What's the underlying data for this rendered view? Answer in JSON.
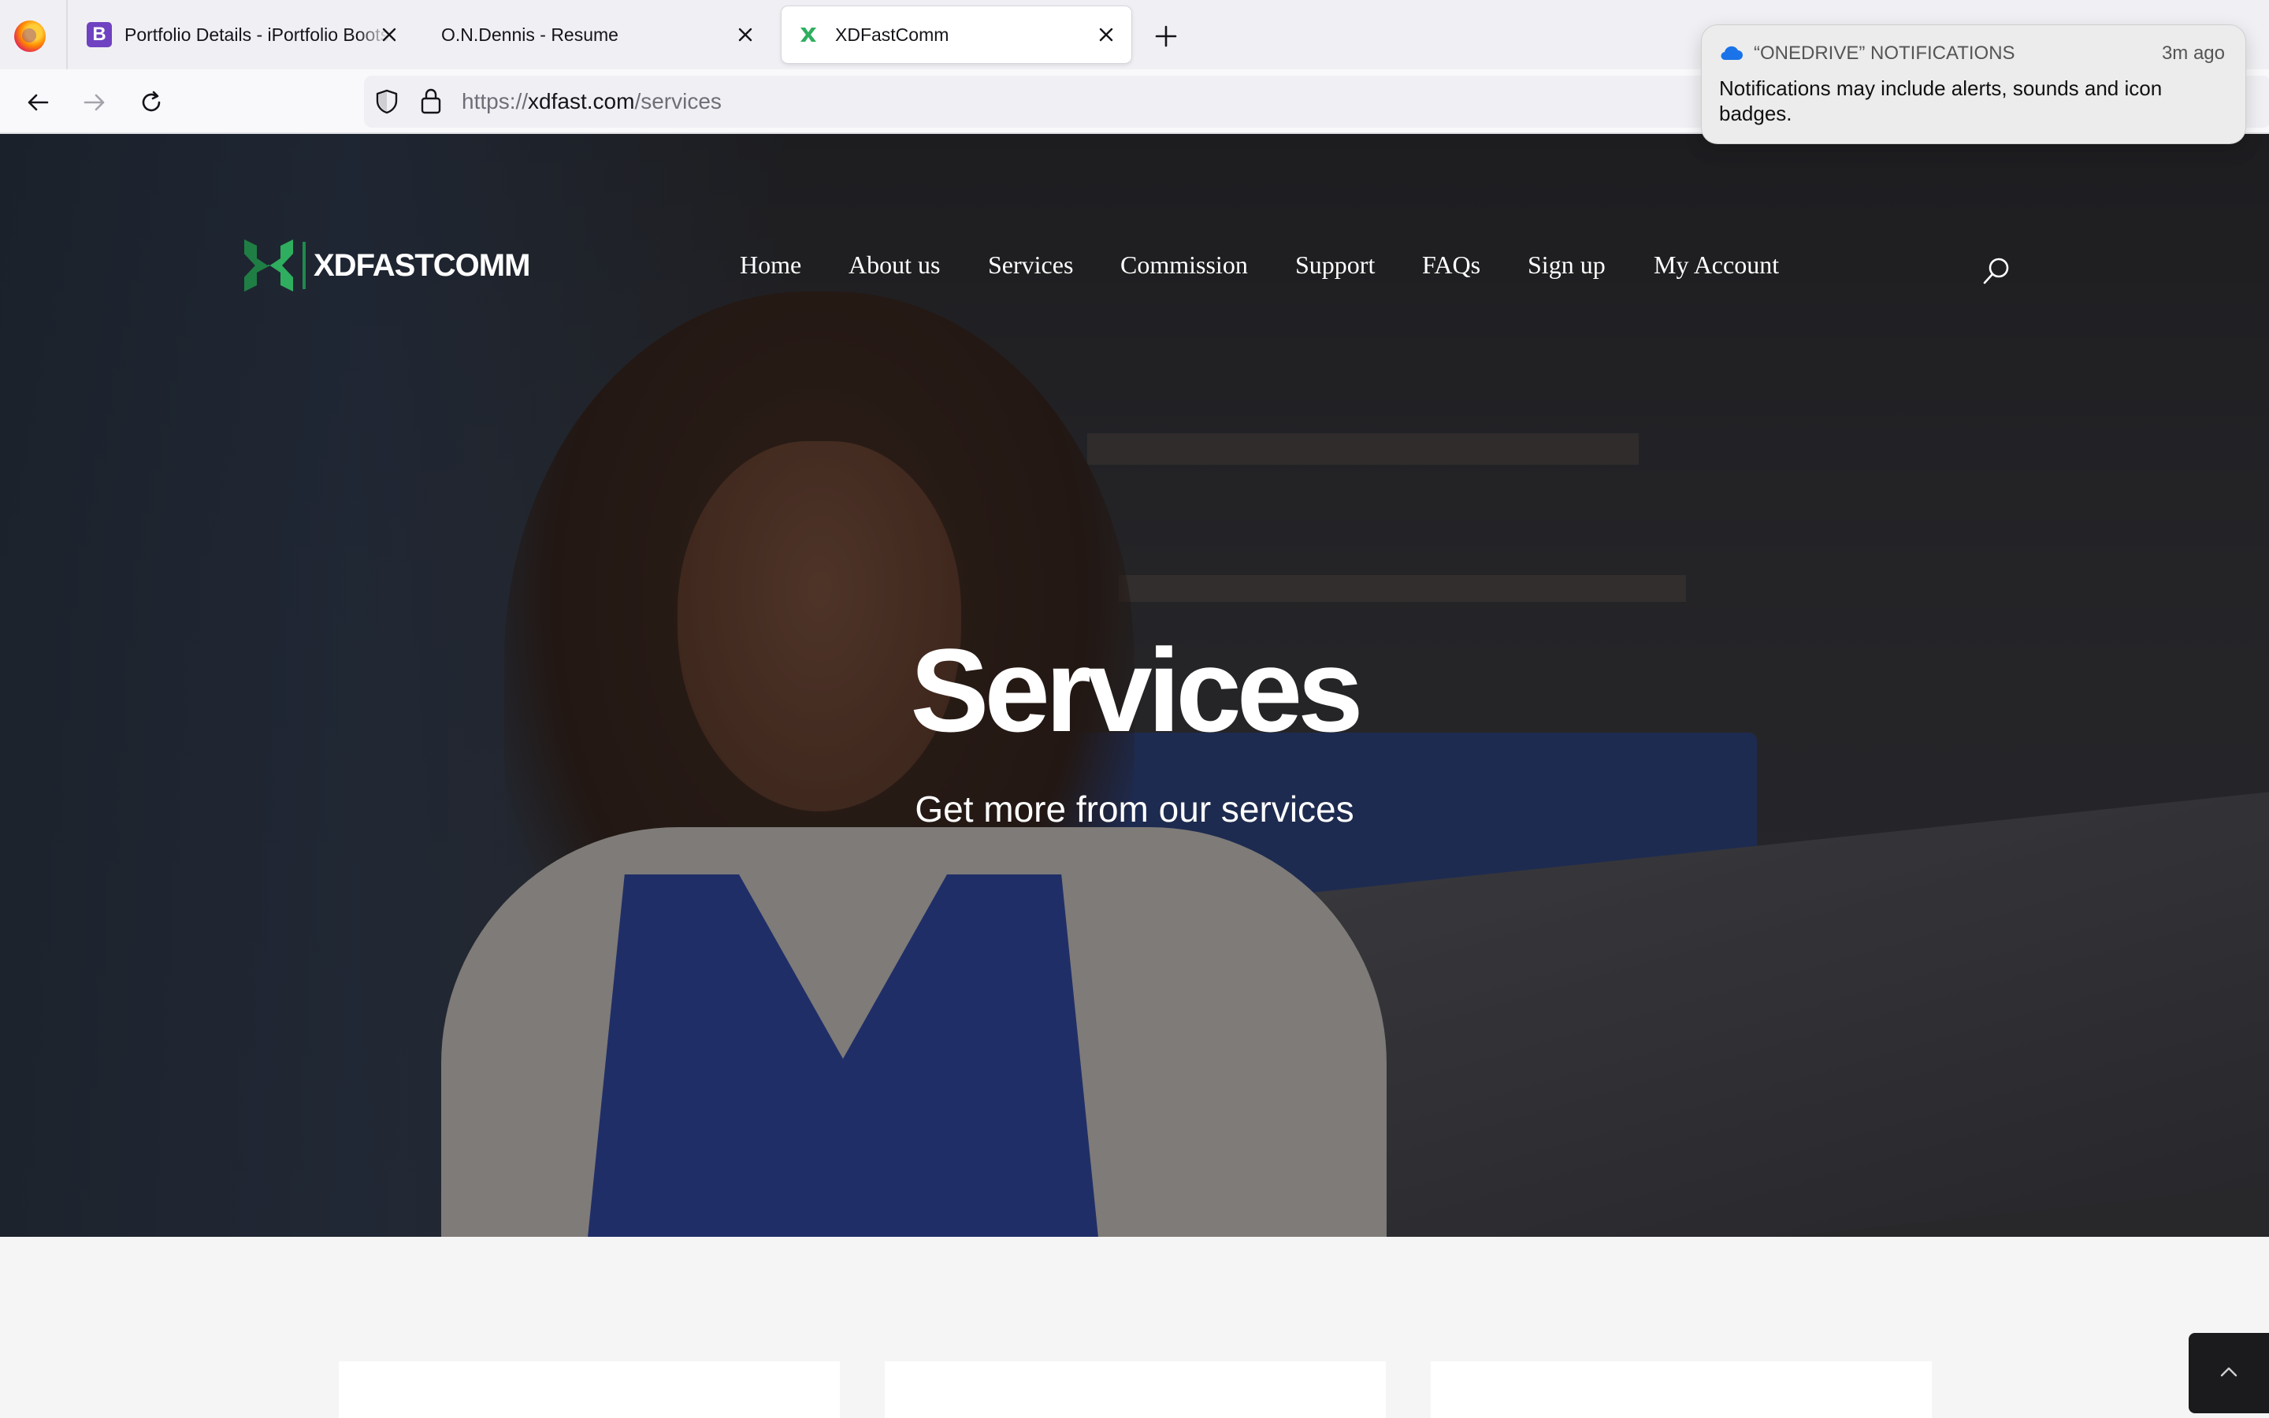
{
  "browser": {
    "tabs": [
      {
        "title": "Portfolio Details - iPortfolio Bootstrap Template",
        "favicon": "bootstrap-icon"
      },
      {
        "title": "O.N.Dennis - Resume",
        "favicon": "none"
      },
      {
        "title": "XDFastComm",
        "favicon": "xdfastcomm-icon",
        "active": true
      }
    ],
    "url": {
      "scheme": "https://",
      "domain": "xdfast.com",
      "path": "/services"
    }
  },
  "site": {
    "logo_text": "XDFASTCOMM",
    "nav": [
      {
        "label": "Home"
      },
      {
        "label": "About us"
      },
      {
        "label": "Services"
      },
      {
        "label": "Commission"
      },
      {
        "label": "Support"
      },
      {
        "label": "FAQs"
      },
      {
        "label": "Sign up"
      },
      {
        "label": "My Account"
      }
    ],
    "hero": {
      "title": "Services",
      "subtitle": "Get more from our services"
    }
  },
  "notification": {
    "app": "“ONEDRIVE” NOTIFICATIONS",
    "time": "3m ago",
    "message": "Notifications may include alerts, sounds and icon badges."
  },
  "colors": {
    "brand_green": "#2fae5f",
    "apron_blue": "#273d94"
  }
}
